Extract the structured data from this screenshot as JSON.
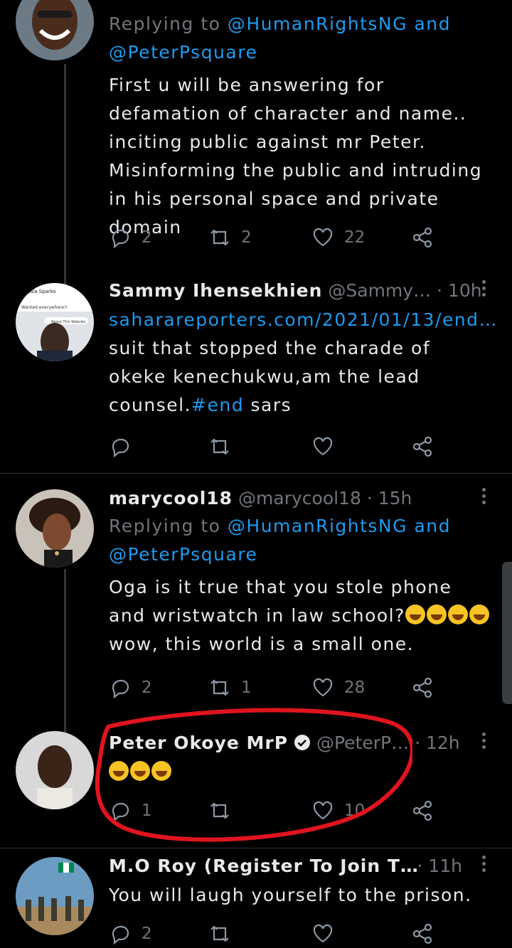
{
  "tweets": [
    {
      "id": "t1",
      "name": "",
      "handle": "",
      "time": "",
      "reply_prefix": "Replying to",
      "reply_mention_1": "@HumanRightsNG",
      "reply_and": "and",
      "reply_mention_2": "@PeterPsquare",
      "text": "First u will be answering for defamation of character and name.. inciting public against mr Peter. Misinforming the public and intruding in his personal space and private domain",
      "replies": "2",
      "retweets": "2",
      "likes": "22"
    },
    {
      "id": "t2",
      "name": "Sammy Ihensekhien",
      "handle": "@Sammy…",
      "time": "· 10h",
      "link_text": "saharareporters.com/2021/01/13/end…",
      "text_after_link": " suit that stopped the charade of okeke kenechukwu,am the lead counsel.",
      "hashtag": "#end",
      "text_end": "sars",
      "replies": "",
      "retweets": "",
      "likes": ""
    },
    {
      "id": "t3",
      "name": "marycool18",
      "handle": "@marycool18",
      "time": "· 15h",
      "reply_prefix": "Replying to",
      "reply_mention_1": "@HumanRightsNG",
      "reply_and": "and",
      "reply_mention_2": "@PeterPsquare",
      "text": "Oga is it true that you stole phone and wristwatch in law school?",
      "text_line2": "wow, this world is a small one.",
      "replies": "2",
      "retweets": "1",
      "likes": "28"
    },
    {
      "id": "t4",
      "name": "Peter Okoye MrP",
      "handle": "@PeterP…",
      "time": "· 12h",
      "replies": "1",
      "retweets": "",
      "likes": "10"
    },
    {
      "id": "t5",
      "name": "M.O Roy (Register To Join T…",
      "handle": "",
      "time": "· 11h",
      "text": "You will laugh yourself to the prison.",
      "replies": "2",
      "retweets": "",
      "likes": ""
    }
  ],
  "avatar2_caption": "Ijala Sparks",
  "avatar2_sub": "Wanted everywhere!!",
  "avatar2_chip": "About This Website",
  "colors": {
    "background": "#000000",
    "text": "#e7e9ea",
    "secondary": "#71767b",
    "link": "#1d9bf0",
    "highlight": "#e0141e"
  },
  "icons": [
    "reply-icon",
    "retweet-icon",
    "like-icon",
    "share-icon",
    "more-icon",
    "verified-icon"
  ]
}
